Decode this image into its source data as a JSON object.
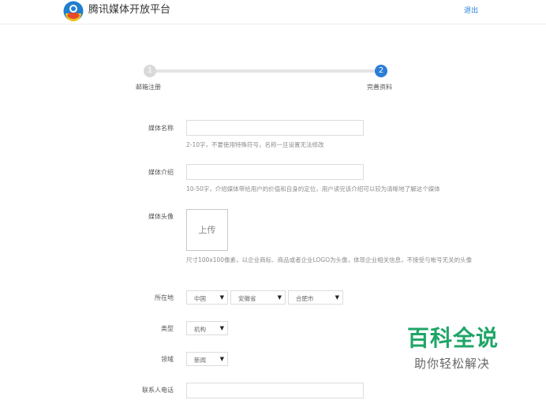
{
  "header": {
    "site_title": "腾讯媒体开放平台",
    "logout_label": "退出"
  },
  "stepper": {
    "steps": [
      {
        "number": "1",
        "label": "邮箱注册"
      },
      {
        "number": "2",
        "label": "完善资料"
      }
    ],
    "current_step": 2
  },
  "form": {
    "media_name": {
      "label": "媒体名称",
      "value": "",
      "hint": "2-10字，不要使用特殊符号，名称一旦设置无法修改"
    },
    "media_intro": {
      "label": "媒体介绍",
      "value": "",
      "hint": "10-50字，介绍媒体带给用户的价值和自身的定位，用户读完该介绍可以较为清晰地了解这个媒体"
    },
    "media_avatar": {
      "label": "媒体头像",
      "upload_label": "上传",
      "hint": "尺寸100x100像素，以企业商标、商品或者企业LOGO为头像，体现企业相关信息，不接受与帐号无关的头像"
    },
    "location": {
      "label": "所在地",
      "country": "中国",
      "province": "安徽省",
      "city": "合肥市"
    },
    "type": {
      "label": "类型",
      "value": "机构"
    },
    "field": {
      "label": "领域",
      "value": "新闻"
    },
    "contact_phone": {
      "label": "联系人电话",
      "value": ""
    }
  },
  "icons": {
    "logo": "tencent-logo-icon",
    "dropdown": "▼"
  },
  "colors": {
    "accent": "#2b7dd6",
    "step_inactive": "#d9d9d9",
    "watermark_green": "#1fa567"
  },
  "watermark": {
    "main": "百科全说",
    "sub": "助你轻松解决"
  }
}
